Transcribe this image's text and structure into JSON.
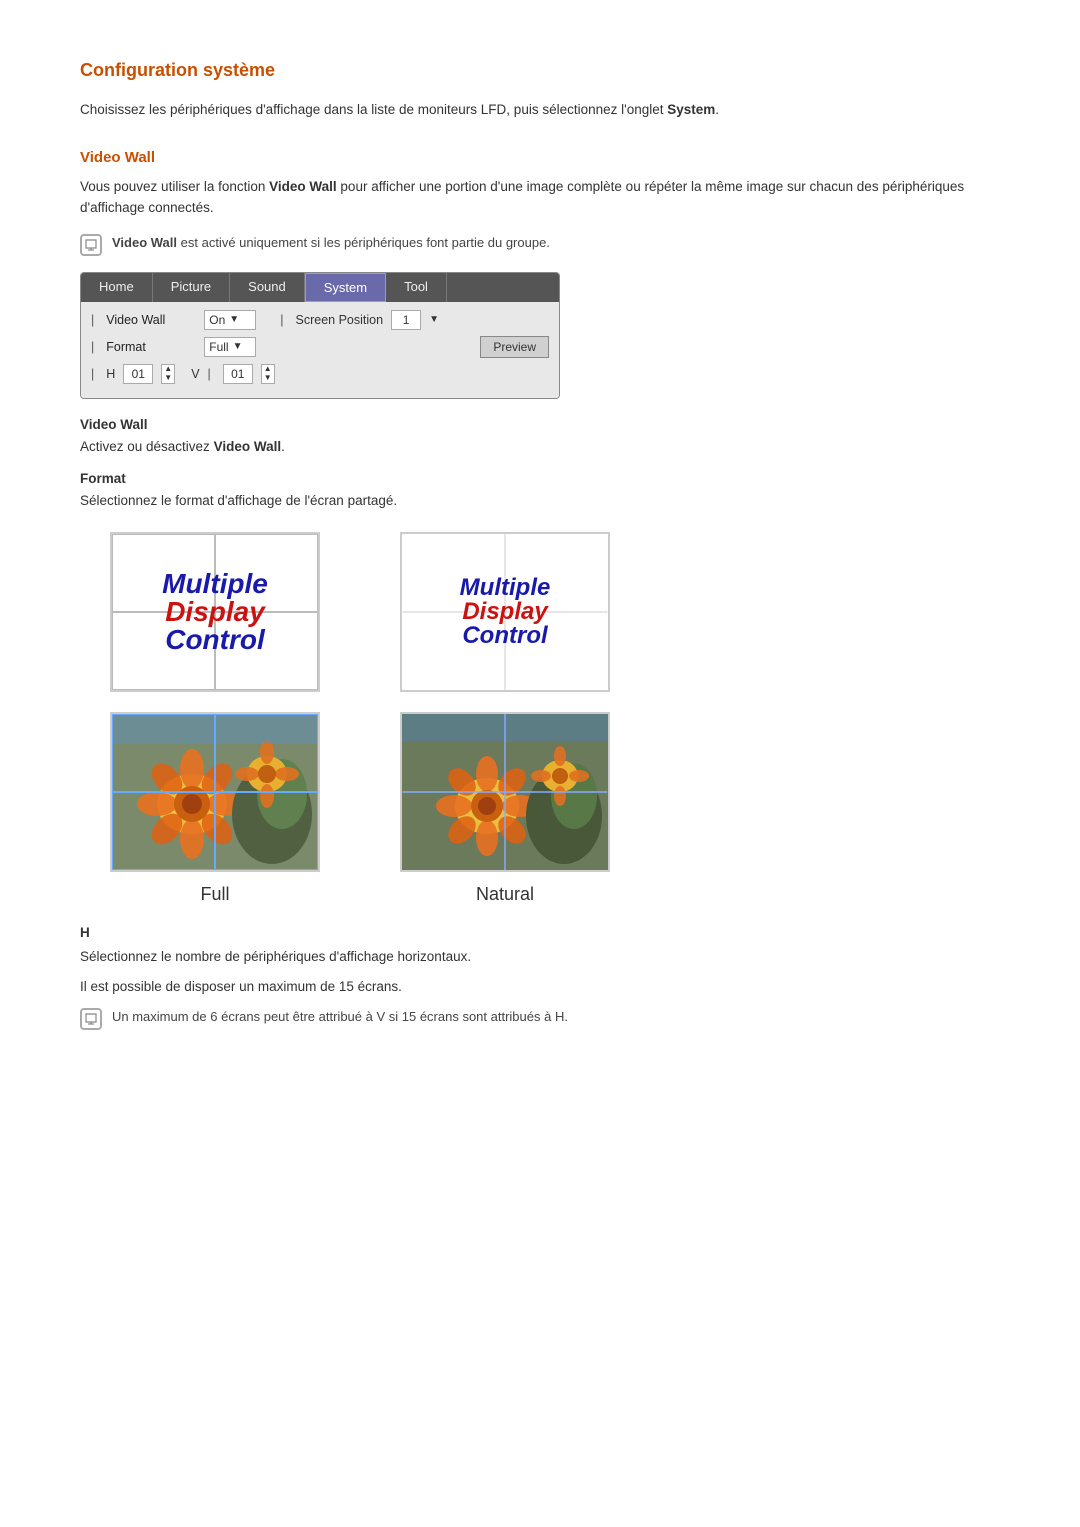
{
  "page": {
    "title": "Configuration système",
    "intro": "Choisissez les périphériques d'affichage dans la liste de moniteurs LFD, puis sélectionnez l'onglet",
    "intro_bold": "System",
    "intro_suffix": ".",
    "section_video_wall": "Video Wall",
    "section_text": "Vous pouvez utiliser la fonction",
    "section_bold": "Video Wall",
    "section_text2": "pour afficher une portion d'une image complète ou répéter la même image sur chacun des périphériques d'affichage connectés.",
    "note1": "Video Wall est activé uniquement si les périphériques font partie du groupe.",
    "panel": {
      "tabs": [
        {
          "label": "Home",
          "active": false
        },
        {
          "label": "Picture",
          "active": false
        },
        {
          "label": "Sound",
          "active": false
        },
        {
          "label": "System",
          "active": true
        },
        {
          "label": "Tool",
          "active": false
        }
      ],
      "rows": [
        {
          "label": "Video Wall",
          "control": "On",
          "sep": "Screen Position",
          "num": "1"
        },
        {
          "label": "Format",
          "control": "Full",
          "preview": "Preview"
        },
        {
          "label": "H",
          "num1": "01",
          "label2": "V",
          "num2": "01"
        }
      ]
    },
    "video_wall_sub": "Video Wall",
    "video_wall_desc": "Activez ou désactivez",
    "video_wall_desc_bold": "Video Wall",
    "video_wall_desc_suffix": ".",
    "format_sub": "Format",
    "format_desc": "Sélectionnez le format d'affichage de l'écran partagé.",
    "images": [
      {
        "type": "mdc_logo",
        "label": "Full"
      },
      {
        "type": "mdc_logo_natural",
        "label": "Natural"
      },
      {
        "type": "flower",
        "label": ""
      },
      {
        "type": "flower_natural",
        "label": ""
      }
    ],
    "full_label": "Full",
    "natural_label": "Natural",
    "h_label": "H",
    "h_desc1": "Sélectionnez le nombre de périphériques d'affichage horizontaux.",
    "h_desc2": "Il est possible de disposer un maximum de 15 écrans.",
    "note2": "Un maximum de 6 écrans peut être attribué à V si 15 écrans sont attribués à H.",
    "mdc_line1": "Multiple",
    "mdc_line2": "Display",
    "mdc_line3": "Control"
  }
}
